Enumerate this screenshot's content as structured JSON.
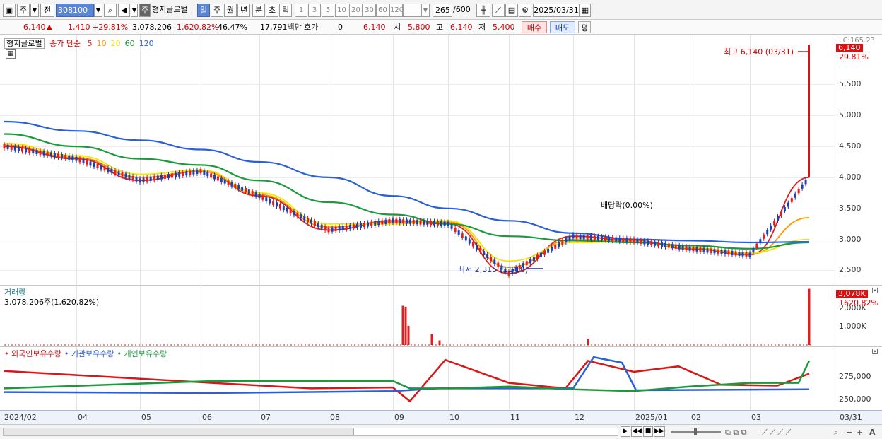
{
  "toolbar": {
    "period_type": "주",
    "prev_label": "전",
    "stock_code": "308100",
    "stock_name_label": "주",
    "stock_name": "형지글로벌",
    "periods": [
      "일",
      "주",
      "월",
      "년",
      "분",
      "초",
      "틱"
    ],
    "active_period": "일",
    "intervals": [
      "1",
      "3",
      "5",
      "10",
      "20",
      "30",
      "60",
      "120"
    ],
    "count": "265",
    "count_max": "/600",
    "date": "2025/03/31"
  },
  "info": {
    "price": "6,140",
    "change": "1,410",
    "change_pct": "+29.81%",
    "volume": "3,078,206",
    "volume_pct": "1,620.82%",
    "turnover_pct": "46.47%",
    "amount": "17,791백만",
    "quote_label": "호가",
    "quote_value": "0",
    "quote_price": "6,140",
    "open_label": "시",
    "open": "5,800",
    "high_label": "고",
    "high": "6,140",
    "low_label": "저",
    "low": "5,400",
    "buy_label": "매수",
    "sell_label": "매도",
    "eval_label": "평"
  },
  "price_pane": {
    "name": "형지글로벌",
    "ma_title": "종가 단순",
    "ma_periods": [
      "5",
      "10",
      "20",
      "60",
      "120"
    ],
    "ma_colors": [
      "#e02020",
      "#ff9900",
      "#f2e600",
      "#1a9a3a",
      "#2a5fd6"
    ],
    "high_note": "최고 6,140 (03/31)",
    "low_note": "최저 2,315 (11/18)",
    "dividend_note": "배당락(0.00%)",
    "last_price_tag": "6,140",
    "change_tag": "29.81%",
    "top_label": "LC:165.23",
    "y_ticks": [
      "5,500",
      "5,000",
      "4,500",
      "4,000",
      "3,500",
      "3,000",
      "2,500"
    ]
  },
  "volume_pane": {
    "title": "거래량",
    "value": "3,078,206주(1,620.82%)",
    "tag_volume": "3,078K",
    "tag_pct": "1620.82%",
    "y_ticks": [
      "2,000K",
      "1,000K"
    ]
  },
  "holding_pane": {
    "series": [
      "외국인보유수량",
      "기관보유수량",
      "개인보유수량"
    ],
    "series_colors": [
      "#d81818",
      "#2a5fd6",
      "#1a9a3a"
    ],
    "y_ticks": [
      "275,000",
      "250,000"
    ]
  },
  "x_axis": [
    "2024/02",
    "04",
    "05",
    "06",
    "07",
    "08",
    "09",
    "10",
    "11",
    "12",
    "2025/01",
    "02",
    "03",
    "03/31"
  ],
  "chart_data": {
    "type": "line",
    "title": "형지글로벌",
    "x": [
      "2024/02",
      "04",
      "05",
      "06",
      "07",
      "08",
      "09",
      "10",
      "11",
      "12",
      "2025/01",
      "02",
      "03",
      "03/31"
    ],
    "series": [
      {
        "name": "5",
        "values": [
          4500,
          4300,
          3950,
          4100,
          3700,
          3150,
          3300,
          3250,
          2450,
          3050,
          2980,
          2850,
          2750,
          4000
        ]
      },
      {
        "name": "10",
        "values": [
          4520,
          4320,
          4000,
          4100,
          3720,
          3200,
          3280,
          3280,
          2550,
          3000,
          2970,
          2860,
          2760,
          3350
        ]
      },
      {
        "name": "20",
        "values": [
          4550,
          4350,
          4050,
          4120,
          3750,
          3250,
          3250,
          3300,
          2650,
          2950,
          2960,
          2870,
          2780,
          3000
        ]
      },
      {
        "name": "60",
        "values": [
          4700,
          4500,
          4300,
          4200,
          3950,
          3600,
          3400,
          3250,
          3050,
          2980,
          2950,
          2900,
          2850,
          2950
        ]
      },
      {
        "name": "120",
        "values": [
          4900,
          4750,
          4600,
          4450,
          4250,
          4000,
          3700,
          3500,
          3300,
          3100,
          3000,
          2980,
          2950,
          2960
        ]
      }
    ],
    "ylim": [
      2300,
      6200
    ],
    "grid": true,
    "legend": "top-left"
  }
}
